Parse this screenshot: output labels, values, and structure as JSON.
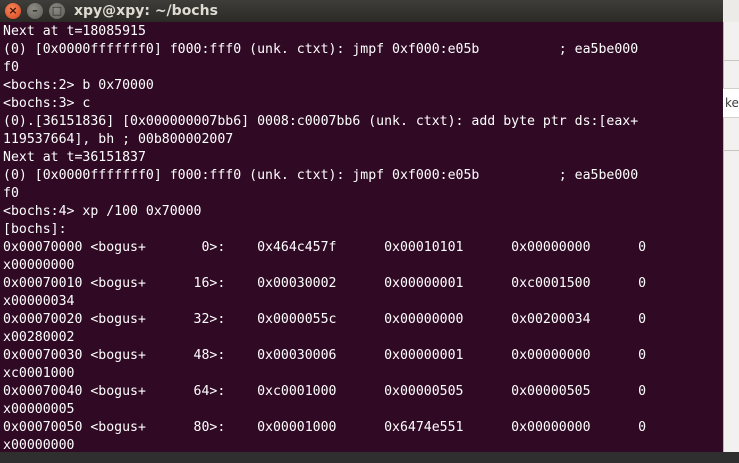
{
  "background_app": {
    "visible_text": "kei"
  },
  "window": {
    "title": "xpy@xpy: ~/bochs",
    "buttons": {
      "close": "×",
      "minimize": "–",
      "maximize": "□"
    }
  },
  "terminal": {
    "lines": [
      "Next at t=18085915",
      "(0) [0x0000fffffff0] f000:fff0 (unk. ctxt): jmpf 0xf000:e05b          ; ea5be000",
      "f0",
      "<bochs:2> b 0x70000",
      "<bochs:3> c",
      "(0).[36151836] [0x000000007bb6] 0008:c0007bb6 (unk. ctxt): add byte ptr ds:[eax+",
      "119537664], bh ; 00b800002007",
      "Next at t=36151837",
      "(0) [0x0000fffffff0] f000:fff0 (unk. ctxt): jmpf 0xf000:e05b          ; ea5be000",
      "f0",
      "<bochs:4> xp /100 0x70000",
      "[bochs]:",
      "0x00070000 <bogus+       0>:    0x464c457f      0x00010101      0x00000000      0",
      "x00000000",
      "0x00070010 <bogus+      16>:    0x00030002      0x00000001      0xc0001500      0",
      "x00000034",
      "0x00070020 <bogus+      32>:    0x0000055c      0x00000000      0x00200034      0",
      "x00280002",
      "0x00070030 <bogus+      48>:    0x00030006      0x00000001      0x00000000      0",
      "xc0001000",
      "0x00070040 <bogus+      64>:    0xc0001000      0x00000505      0x00000505      0",
      "x00000005",
      "0x00070050 <bogus+      80>:    0x00001000      0x6474e551      0x00000000      0",
      "x00000000"
    ]
  },
  "colors": {
    "terminal_bg": "#300a24",
    "terminal_fg": "#ffffff",
    "titlebar": "#3c3b37",
    "close_button": "#e95420"
  }
}
